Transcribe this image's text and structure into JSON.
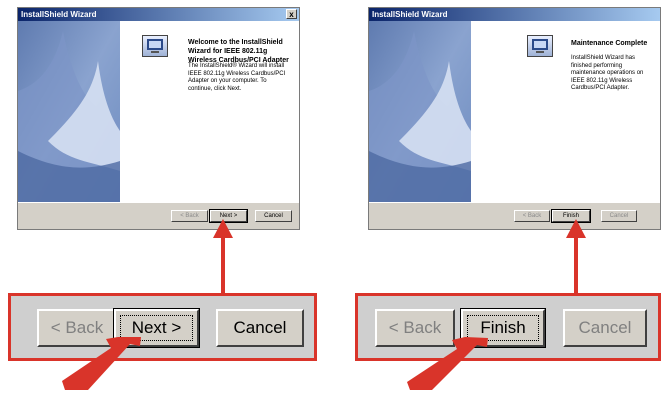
{
  "left_dialog": {
    "title": "InstallShield Wizard",
    "close_glyph": "x",
    "heading": "Welcome to the InstallShield Wizard for IEEE 802.11g Wireless Cardbus/PCI Adapter",
    "body": "The InstallShield® Wizard will install IEEE 802.11g Wireless Cardbus/PCI Adapter on your computer.  To continue, click Next.",
    "back_label": "< Back",
    "next_label": "Next >",
    "cancel_label": "Cancel"
  },
  "right_dialog": {
    "title": "InstallShield Wizard",
    "heading": "Maintenance Complete",
    "body": "InstallShield Wizard has finished performing maintenance operations on IEEE 802.11g Wireless Cardbus/PCI Adapter.",
    "back_label": "< Back",
    "finish_label": "Finish",
    "cancel_label": "Cancel"
  },
  "left_zoom": {
    "back_label": "< Back",
    "next_label": "Next >",
    "cancel_label": "Cancel"
  },
  "right_zoom": {
    "back_label": "< Back",
    "finish_label": "Finish",
    "cancel_label": "Cancel"
  },
  "colors": {
    "annotation_red": "#d9342a",
    "titlebar_dark": "#0a246a",
    "titlebar_light": "#a6caf0",
    "dialog_face": "#d4d0c8"
  },
  "icons": [
    "computer-icon",
    "close-icon",
    "red-arrow-up",
    "red-pointer-arrow"
  ]
}
